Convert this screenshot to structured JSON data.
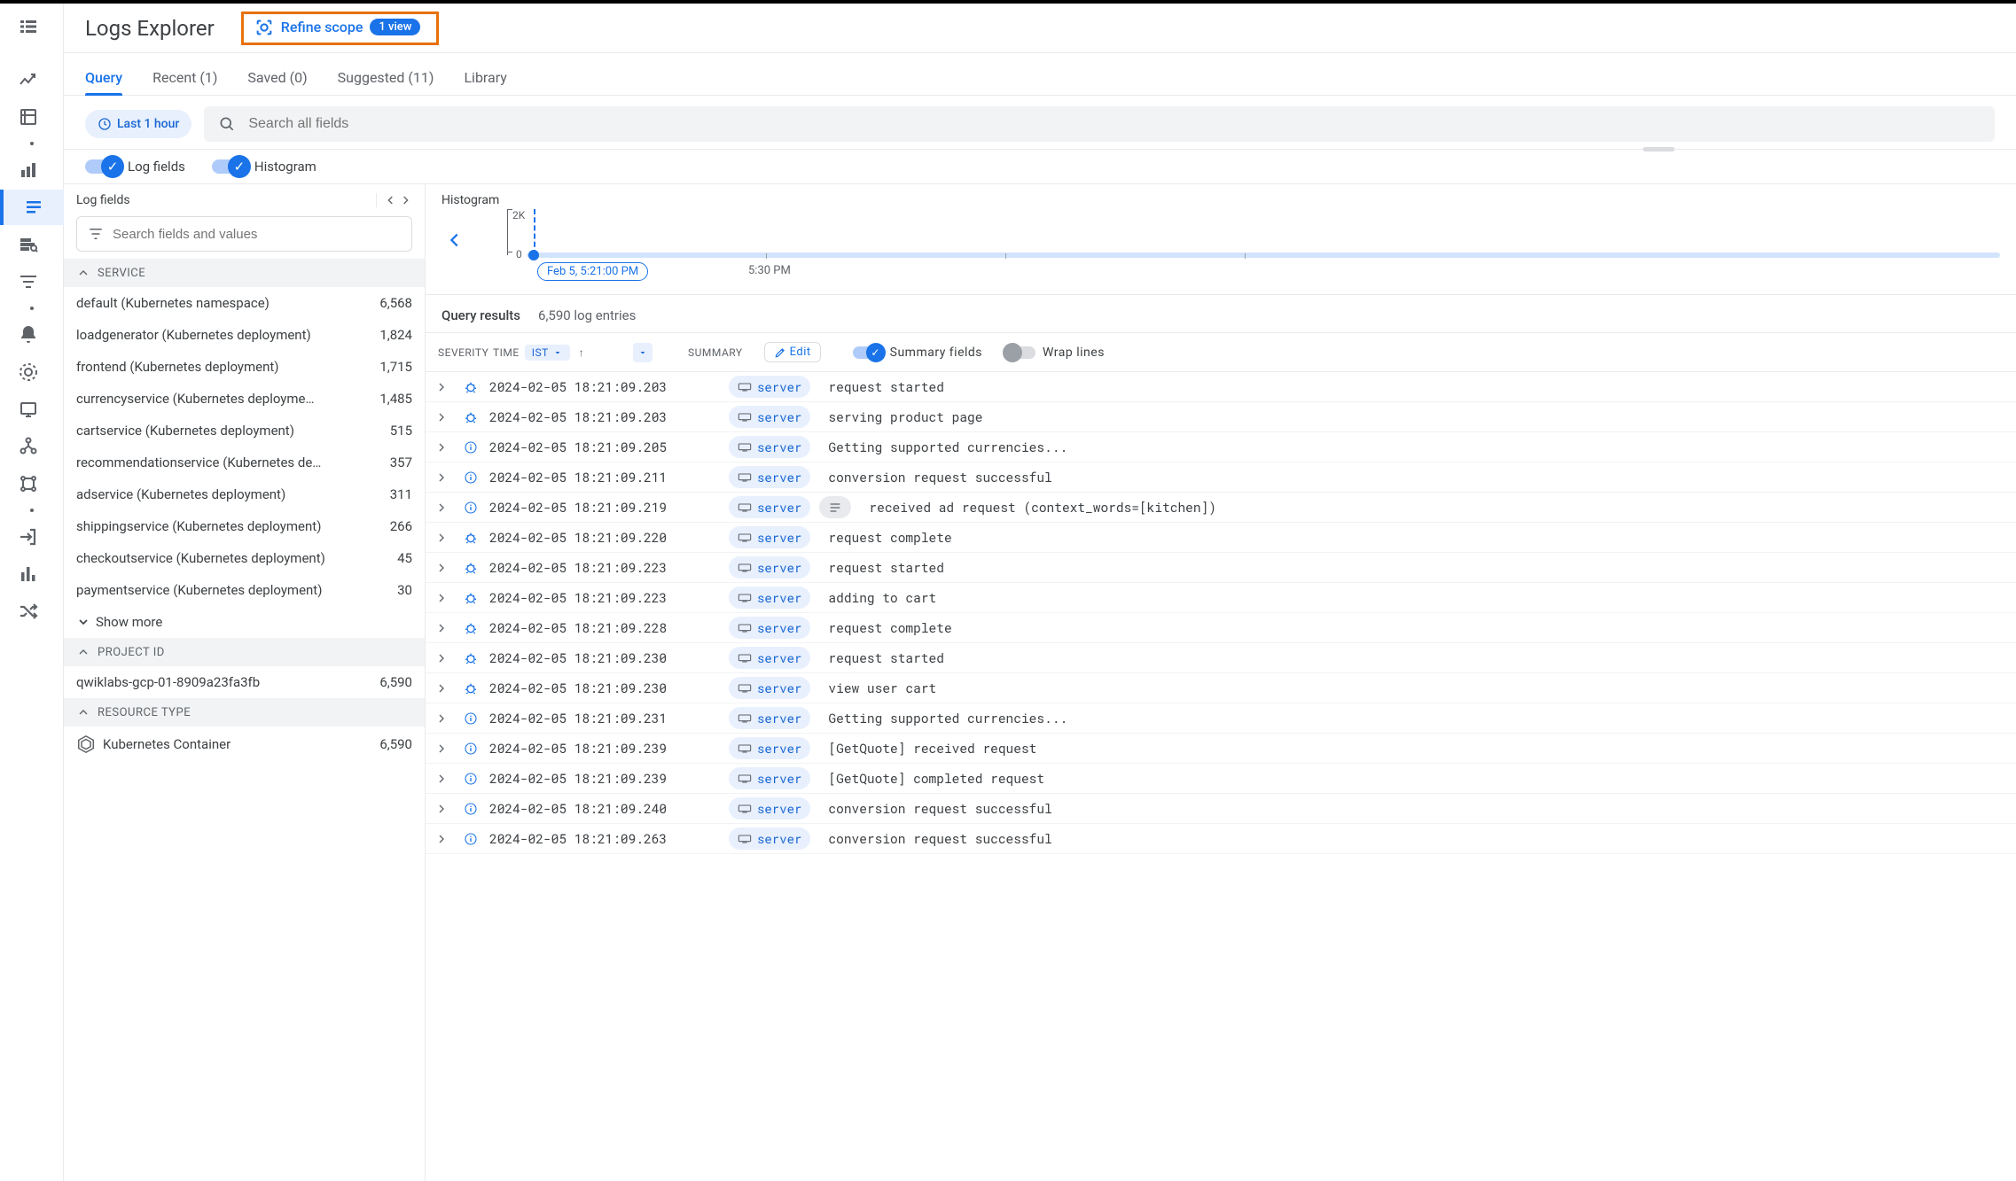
{
  "header": {
    "title": "Logs Explorer",
    "refine_label": "Refine scope",
    "refine_badge": "1 view"
  },
  "tabs": [
    {
      "label": "Query",
      "active": true
    },
    {
      "label": "Recent (1)"
    },
    {
      "label": "Saved (0)"
    },
    {
      "label": "Suggested (11)"
    },
    {
      "label": "Library"
    }
  ],
  "time_chip": "Last 1 hour",
  "search_placeholder": "Search all fields",
  "toggles": {
    "log_fields": "Log fields",
    "histogram": "Histogram"
  },
  "fields_panel": {
    "title": "Log fields",
    "search_placeholder": "Search fields and values",
    "show_more": "Show more",
    "groups": {
      "service": {
        "label": "SERVICE",
        "items": [
          {
            "name": "default (Kubernetes namespace)",
            "count": "6,568"
          },
          {
            "name": "loadgenerator (Kubernetes deployment)",
            "count": "1,824"
          },
          {
            "name": "frontend (Kubernetes deployment)",
            "count": "1,715"
          },
          {
            "name": "currencyservice (Kubernetes deployme…",
            "count": "1,485"
          },
          {
            "name": "cartservice (Kubernetes deployment)",
            "count": "515"
          },
          {
            "name": "recommendationservice (Kubernetes de…",
            "count": "357"
          },
          {
            "name": "adservice (Kubernetes deployment)",
            "count": "311"
          },
          {
            "name": "shippingservice (Kubernetes deployment)",
            "count": "266"
          },
          {
            "name": "checkoutservice (Kubernetes deployment)",
            "count": "45"
          },
          {
            "name": "paymentservice (Kubernetes deployment)",
            "count": "30"
          }
        ]
      },
      "project_id": {
        "label": "PROJECT ID",
        "items": [
          {
            "name": "qwiklabs-gcp-01-8909a23fa3fb",
            "count": "6,590"
          }
        ]
      },
      "resource_type": {
        "label": "RESOURCE TYPE",
        "items": [
          {
            "name": "Kubernetes Container",
            "count": "6,590",
            "icon": "k8s"
          }
        ]
      }
    }
  },
  "histogram": {
    "title": "Histogram",
    "y_max": "2K",
    "y_min": "0",
    "start_chip": "Feb 5, 5:21:00 PM",
    "tick1": "5:30 PM"
  },
  "results": {
    "title": "Query results",
    "count": "6,590 log entries",
    "columns": {
      "severity": "SEVERITY",
      "time": "TIME",
      "tz": "IST",
      "summary": "SUMMARY",
      "edit": "Edit",
      "summary_fields": "Summary fields",
      "wrap_lines": "Wrap lines"
    }
  },
  "server_chip": "server",
  "logs": [
    {
      "sev": "debug",
      "ts": "2024-02-05 18:21:09.203",
      "msg": "request started"
    },
    {
      "sev": "debug",
      "ts": "2024-02-05 18:21:09.203",
      "msg": "serving product page"
    },
    {
      "sev": "info",
      "ts": "2024-02-05 18:21:09.205",
      "msg": "Getting supported currencies..."
    },
    {
      "sev": "info",
      "ts": "2024-02-05 18:21:09.211",
      "msg": "conversion request successful"
    },
    {
      "sev": "info",
      "ts": "2024-02-05 18:21:09.219",
      "msg": "received ad request (context_words=[kitchen])",
      "extra_chip": true
    },
    {
      "sev": "debug",
      "ts": "2024-02-05 18:21:09.220",
      "msg": "request complete"
    },
    {
      "sev": "debug",
      "ts": "2024-02-05 18:21:09.223",
      "msg": "request started"
    },
    {
      "sev": "debug",
      "ts": "2024-02-05 18:21:09.223",
      "msg": "adding to cart"
    },
    {
      "sev": "debug",
      "ts": "2024-02-05 18:21:09.228",
      "msg": "request complete"
    },
    {
      "sev": "debug",
      "ts": "2024-02-05 18:21:09.230",
      "msg": "request started"
    },
    {
      "sev": "debug",
      "ts": "2024-02-05 18:21:09.230",
      "msg": "view user cart"
    },
    {
      "sev": "info",
      "ts": "2024-02-05 18:21:09.231",
      "msg": "Getting supported currencies..."
    },
    {
      "sev": "info",
      "ts": "2024-02-05 18:21:09.239",
      "msg": "[GetQuote] received request"
    },
    {
      "sev": "info",
      "ts": "2024-02-05 18:21:09.239",
      "msg": "[GetQuote] completed request"
    },
    {
      "sev": "info",
      "ts": "2024-02-05 18:21:09.240",
      "msg": "conversion request successful"
    },
    {
      "sev": "info",
      "ts": "2024-02-05 18:21:09.263",
      "msg": "conversion request successful"
    }
  ]
}
